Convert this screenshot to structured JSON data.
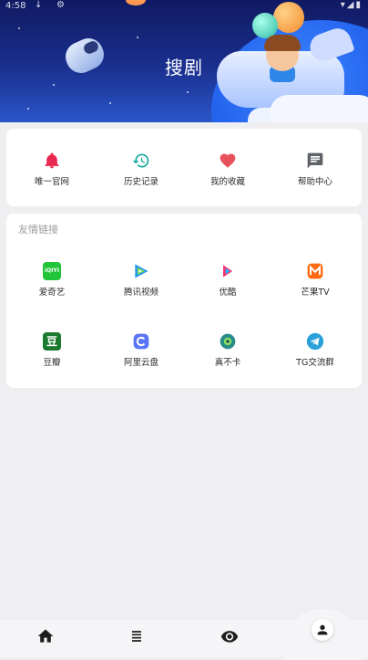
{
  "status_bar": {
    "time": "4:58",
    "download_glyph": "↓",
    "settings_glyph": "⚙",
    "signal_glyphs": "▾◢▮"
  },
  "banner": {
    "title": "搜剧"
  },
  "quick_actions": [
    {
      "label": "唯一官网",
      "icon": "bell-icon",
      "color": "#e8284f"
    },
    {
      "label": "历史记录",
      "icon": "history-icon",
      "color": "#12a99c"
    },
    {
      "label": "我的收藏",
      "icon": "heart-icon",
      "color": "#e8505b"
    },
    {
      "label": "帮助中心",
      "icon": "message-icon",
      "color": "#5f6368"
    }
  ],
  "links_section": {
    "title": "友情链接",
    "items": [
      {
        "label": "爱奇艺",
        "icon": "iqiyi-logo-icon",
        "logo_text": "iQIYI",
        "color": "#22c43a"
      },
      {
        "label": "腾讯视频",
        "icon": "tencent-video-logo-icon",
        "color": "#2196f3"
      },
      {
        "label": "优酷",
        "icon": "youku-logo-icon",
        "color": "#ff2d6c"
      },
      {
        "label": "芒果TV",
        "icon": "mango-tv-logo-icon",
        "color": "#ff6a13"
      },
      {
        "label": "豆瓣",
        "icon": "douban-logo-icon",
        "logo_text": "豆",
        "color": "#1b7a2f"
      },
      {
        "label": "阿里云盘",
        "icon": "aliyun-drive-logo-icon",
        "color": "#5a74f5"
      },
      {
        "label": "真不卡",
        "icon": "zhenbuka-logo-icon",
        "color": "#2a8c8a"
      },
      {
        "label": "TG交流群",
        "icon": "telegram-logo-icon",
        "color": "#2aa1da"
      }
    ]
  },
  "bottom_nav": [
    {
      "name": "home",
      "icon": "home-icon"
    },
    {
      "name": "list",
      "icon": "list-icon"
    },
    {
      "name": "watch",
      "icon": "eye-icon"
    },
    {
      "name": "profile",
      "icon": "person-icon"
    }
  ]
}
